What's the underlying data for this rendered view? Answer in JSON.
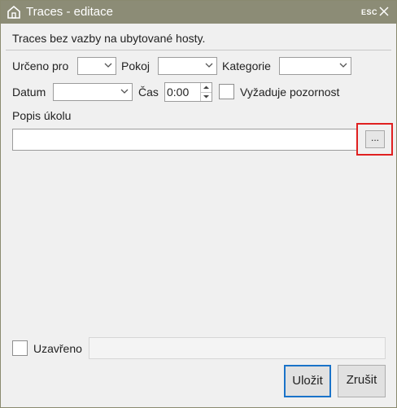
{
  "window": {
    "title": "Traces - editace",
    "esc_label": "ESC",
    "app_icon": "house-icon",
    "close_icon": "close-icon"
  },
  "info_text": "Traces bez vazby na ubytované hosty.",
  "form": {
    "urceno_label": "Určeno pro",
    "urceno_value": "",
    "pokoj_label": "Pokoj",
    "pokoj_value": "",
    "kategorie_label": "Kategorie",
    "kategorie_value": "",
    "datum_label": "Datum",
    "datum_value": "",
    "cas_label": "Čas",
    "cas_value": "0:00",
    "pozornost_label": "Vyžaduje pozornost",
    "pozornost_checked": false,
    "popis_label": "Popis úkolu",
    "popis_value": "",
    "browse_label": "..."
  },
  "footer": {
    "uzavreno_label": "Uzavřeno",
    "uzavreno_checked": false,
    "uzavreno_value": "",
    "save_label": "Uložit",
    "cancel_label": "Zrušit"
  },
  "colors": {
    "titlebar": "#8c8c76",
    "highlight": "#e02020",
    "primary_border": "#1a73c9"
  }
}
